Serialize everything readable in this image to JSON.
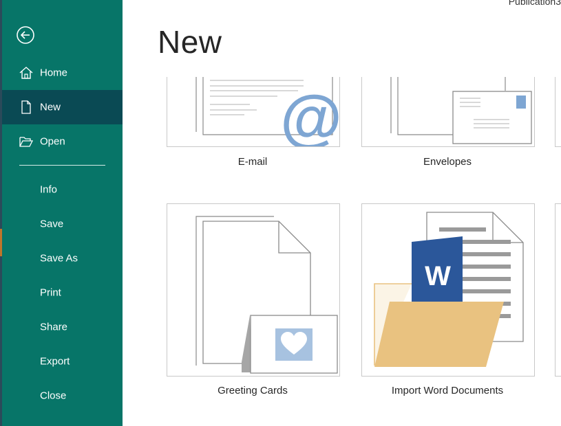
{
  "window": {
    "doc_title": "Publication3"
  },
  "nav": {
    "back_icon": "back-arrow-icon",
    "items": [
      {
        "label": "Home",
        "icon": "home-icon"
      },
      {
        "label": "New",
        "icon": "new-document-icon",
        "selected": true
      },
      {
        "label": "Open",
        "icon": "open-folder-icon"
      },
      {
        "label": "Info"
      },
      {
        "label": "Save"
      },
      {
        "label": "Save As"
      },
      {
        "label": "Print"
      },
      {
        "label": "Share"
      },
      {
        "label": "Export"
      },
      {
        "label": "Close"
      }
    ]
  },
  "main": {
    "heading": "New",
    "templates": [
      {
        "label": "E-mail",
        "icon": "email-template-icon"
      },
      {
        "label": "Envelopes",
        "icon": "envelope-template-icon"
      },
      {
        "label": "Greeting Cards",
        "icon": "greeting-card-template-icon"
      },
      {
        "label": "Import Word Documents",
        "icon": "import-word-template-icon"
      }
    ]
  },
  "colors": {
    "nav_background": "#077568",
    "nav_selected": "#0a4a54",
    "word_blue": "#2b579a",
    "accent_blue": "#7ea6d3",
    "folder_tan": "#e9c280"
  }
}
